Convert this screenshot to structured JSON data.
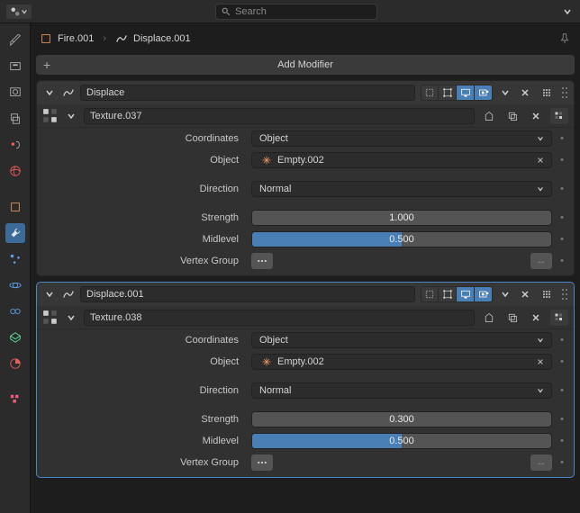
{
  "topbar": {
    "search_placeholder": "Search"
  },
  "breadcrumb": {
    "obj_name": "Fire.001",
    "mod_name": "Displace.001"
  },
  "add_modifier_label": "Add Modifier",
  "side_rail": {
    "items": [
      "tool",
      "render",
      "output",
      "view-layer",
      "scene",
      "world",
      "spacer",
      "object",
      "wrench",
      "constraints",
      "particles",
      "physics",
      "object-data",
      "material",
      "spacer",
      "texture"
    ],
    "active": "wrench"
  },
  "modifiers": [
    {
      "name": "Displace",
      "texture": "Texture.037",
      "selected": false,
      "fields": {
        "coordinates_label": "Coordinates",
        "coordinates_value": "Object",
        "object_label": "Object",
        "object_value": "Empty.002",
        "direction_label": "Direction",
        "direction_value": "Normal",
        "strength_label": "Strength",
        "strength_value": "1.000",
        "midlevel_label": "Midlevel",
        "midlevel_value": "0.500",
        "midlevel_pct": 50,
        "vertex_group_label": "Vertex Group"
      }
    },
    {
      "name": "Displace.001",
      "texture": "Texture.038",
      "selected": true,
      "fields": {
        "coordinates_label": "Coordinates",
        "coordinates_value": "Object",
        "object_label": "Object",
        "object_value": "Empty.002",
        "direction_label": "Direction",
        "direction_value": "Normal",
        "strength_label": "Strength",
        "strength_value": "0.300",
        "midlevel_label": "Midlevel",
        "midlevel_value": "0.500",
        "midlevel_pct": 50,
        "vertex_group_label": "Vertex Group"
      }
    }
  ]
}
